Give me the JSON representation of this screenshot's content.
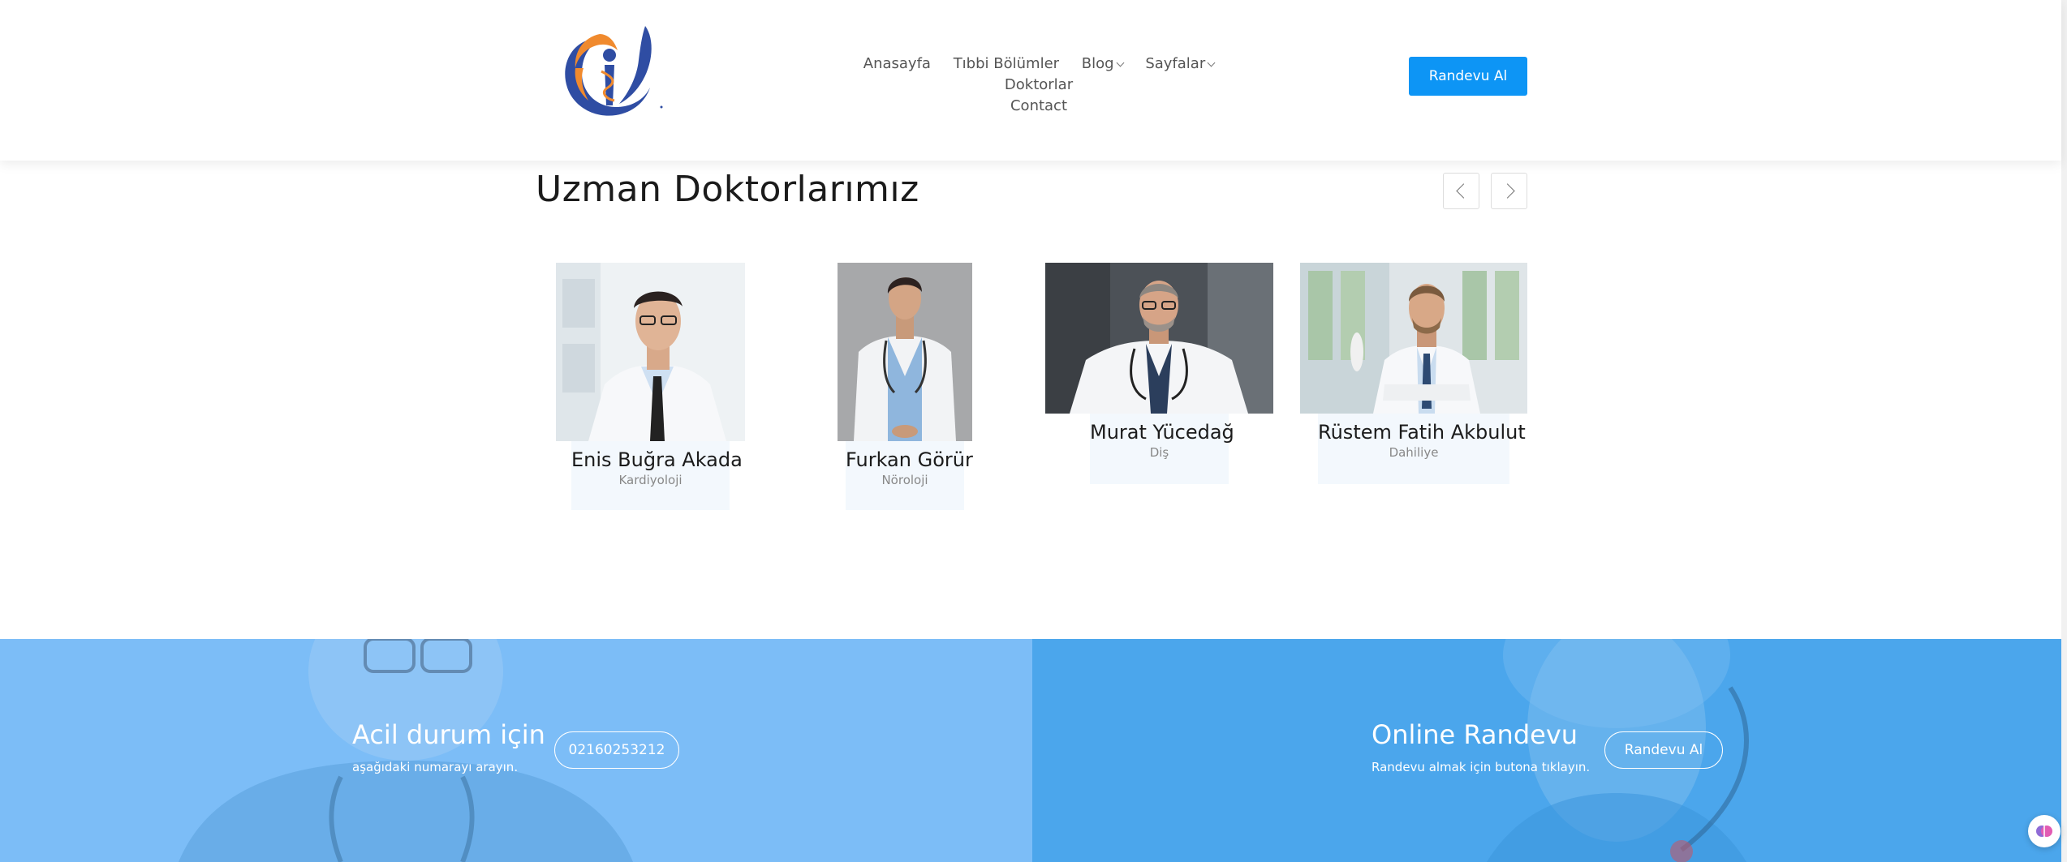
{
  "header": {
    "logo_name": "hand-medical-logo",
    "nav": [
      {
        "label": "Anasayfa",
        "dropdown": false
      },
      {
        "label": "Tıbbi Bölümler",
        "dropdown": false
      },
      {
        "label": "Blog",
        "dropdown": true
      },
      {
        "label": "Sayfalar",
        "dropdown": true
      },
      {
        "label": "Doktorlar",
        "dropdown": false
      },
      {
        "label": "Contact",
        "dropdown": false
      }
    ],
    "cta_label": "Randevu Al"
  },
  "section": {
    "title": "Uzman Doktorlarımız",
    "prev_icon": "chevron-left-icon",
    "next_icon": "chevron-right-icon"
  },
  "doctors": [
    {
      "name": "Enis Buğra Akada",
      "department": "Kardiyoloji"
    },
    {
      "name": "Furkan Görür",
      "department": "Nöroloji"
    },
    {
      "name": "Murat Yücedağ",
      "department": "Diş"
    },
    {
      "name": "Rüstem Fatih Akbulut",
      "department": "Dahiliye"
    }
  ],
  "banner": {
    "emergency": {
      "title": "Acil durum için",
      "subtitle": "aşağıdaki numarayı arayın.",
      "phone": "02160253212"
    },
    "online": {
      "title": "Online Randevu",
      "subtitle": "Randevu almak için butona tıklayın.",
      "button": "Randevu Al"
    }
  },
  "colors": {
    "primary": "#0d95f5",
    "banner_left": "#7cbdf7",
    "banner_right": "#4ba6ec",
    "logo_orange": "#f08a2e",
    "logo_blue": "#2f4da3"
  }
}
